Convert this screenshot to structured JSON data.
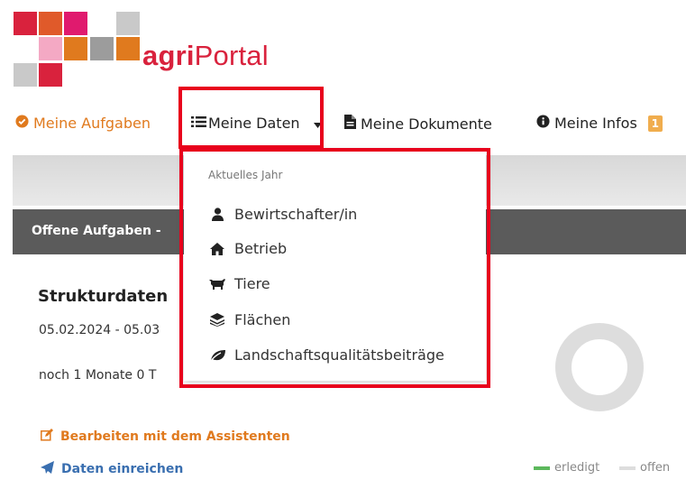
{
  "brand": {
    "name_bold": "agri",
    "name_rest": "Portal"
  },
  "nav": {
    "tasks": "Meine Aufgaben",
    "data": "Meine Daten",
    "documents": "Meine Dokumente",
    "infos": "Meine Infos",
    "infos_badge": "1"
  },
  "dropdown": {
    "header": "Aktuelles Jahr",
    "items": [
      {
        "label": "Bewirtschafter/in",
        "icon": "user-icon"
      },
      {
        "label": "Betrieb",
        "icon": "home-icon"
      },
      {
        "label": "Tiere",
        "icon": "cow-icon"
      },
      {
        "label": "Flächen",
        "icon": "layers-icon"
      },
      {
        "label": "Landschaftsqualitätsbeiträge",
        "icon": "leaf-icon"
      }
    ]
  },
  "section": {
    "title": "Offene Aufgaben -"
  },
  "task": {
    "title": "Strukturdaten",
    "date": "05.02.2024 - 05.03",
    "remaining": "noch 1 Monate 0 T",
    "edit_link": "Bearbeiten mit dem Assistenten",
    "submit_link": "Daten einreichen"
  },
  "legend": {
    "done": "erledigt",
    "open": "offen",
    "done_color": "#5cb85c",
    "open_color": "#dddddd"
  },
  "colors": {
    "accent": "#e07a1e",
    "brand": "#d9223d",
    "highlight": "#e8001c"
  }
}
